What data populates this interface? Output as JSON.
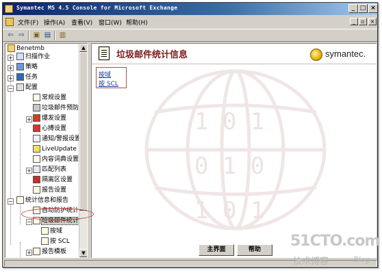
{
  "window": {
    "title": "Symantec MS 4.5 Console for Microsoft Exchange",
    "controls": {
      "minimize": "_",
      "maximize": "□",
      "close": "×"
    }
  },
  "menu": {
    "items": [
      "文件(F)",
      "操作(A)",
      "查看(V)",
      "窗口(W)",
      "帮助(H)"
    ],
    "mdi_controls": {
      "minimize": "_",
      "restore": "▫",
      "close": "×"
    }
  },
  "toolbar": {
    "buttons": [
      {
        "icon": "back-arrow-icon",
        "glyph": "⇦"
      },
      {
        "icon": "forward-arrow-icon",
        "glyph": "⇨"
      },
      {
        "icon": "up-folder-icon",
        "glyph": "▣"
      },
      {
        "icon": "show-hide-tree-icon",
        "glyph": "▤"
      },
      {
        "icon": "properties-icon",
        "glyph": "▥"
      }
    ]
  },
  "tree": {
    "items": [
      {
        "label": "Benetmb",
        "expander": ""
      },
      {
        "label": "扫描作业",
        "expander": "+"
      },
      {
        "label": "策略",
        "expander": "+"
      },
      {
        "label": "任务",
        "expander": "+"
      },
      {
        "label": "配置",
        "expander": "−"
      },
      {
        "label": "常规设置",
        "expander": ""
      },
      {
        "label": "垃圾邮件预防设置",
        "expander": ""
      },
      {
        "label": "爆发设置",
        "expander": "+"
      },
      {
        "label": "心搏设置",
        "expander": ""
      },
      {
        "label": "通知/警报设置",
        "expander": ""
      },
      {
        "label": "LiveUpdate 设置",
        "expander": ""
      },
      {
        "label": "内容词典设置",
        "expander": ""
      },
      {
        "label": "匹配列表",
        "expander": "+"
      },
      {
        "label": "隔离区设置",
        "expander": ""
      },
      {
        "label": "报告设置",
        "expander": ""
      },
      {
        "label": "统计信息和报告",
        "expander": "−"
      },
      {
        "label": "自动防护统计信息",
        "expander": ""
      },
      {
        "label": "垃圾邮件统计信息",
        "expander": "−"
      },
      {
        "label": "按域",
        "expander": ""
      },
      {
        "label": "按 SCL",
        "expander": ""
      },
      {
        "label": "报告模板",
        "expander": "+"
      }
    ]
  },
  "content": {
    "title": "垃圾邮件统计信息",
    "brand": "symantec.",
    "links": [
      "按域",
      "按 SCL"
    ],
    "buttons": {
      "home": "主界面",
      "help": "帮助"
    }
  },
  "watermark": {
    "site": "51CTO.com",
    "tagline": "技术博客",
    "blog": "Blog"
  },
  "colors": {
    "titlebar_start": "#0a246a",
    "titlebar_end": "#a6caf0",
    "page_title": "#7a1a1a",
    "link": "#1a3a9a",
    "highlight": "#c04040"
  }
}
